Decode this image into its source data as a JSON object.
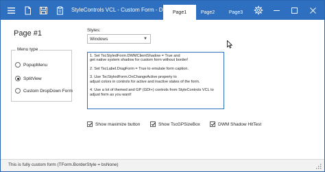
{
  "titlebar": {
    "title": "StyleControls VCL - Custom Form - Demo",
    "icons": [
      "menu-icon",
      "document-icon",
      "save-icon",
      "clipboard-icon"
    ],
    "tabs": [
      {
        "label": "Page1",
        "active": true
      },
      {
        "label": "Page2",
        "active": false
      },
      {
        "label": "Page3",
        "active": false
      }
    ],
    "accent_color": "#2f6fbf"
  },
  "page": {
    "title": "Page #1"
  },
  "menu_type": {
    "label": "Menu type",
    "options": [
      {
        "label": "PopupMenu",
        "selected": false
      },
      {
        "label": "SplitView",
        "selected": true
      },
      {
        "label": "Custom DropDown Form",
        "selected": false
      }
    ]
  },
  "styles": {
    "label": "Styles:",
    "selected": "Windows"
  },
  "memo": {
    "lines": [
      "1. Set TscStyledForm.DWMClientShadow = True and",
      "get native system shadow for custom form without border!",
      "",
      "2. Set TscLabel.DragForm = True to emulate form caption.",
      "",
      "3. Use TscStyledForm.OnChangeActive property to",
      "adjust colors in controls for active and inactive states of the form.",
      "",
      "4. Use a lot of themed and GP (GDI+) controls from StyleControls VCL to",
      "adjust form as you want!"
    ]
  },
  "checkboxes": [
    {
      "label": "Show maximize button",
      "checked": true
    },
    {
      "label": "Show TscGPSizeBox",
      "checked": true
    },
    {
      "label": "DWM Shadow HitTest",
      "checked": true
    }
  ],
  "status": {
    "text": "This is fully custom form (TForm.BorderStyle = bsNone)"
  }
}
